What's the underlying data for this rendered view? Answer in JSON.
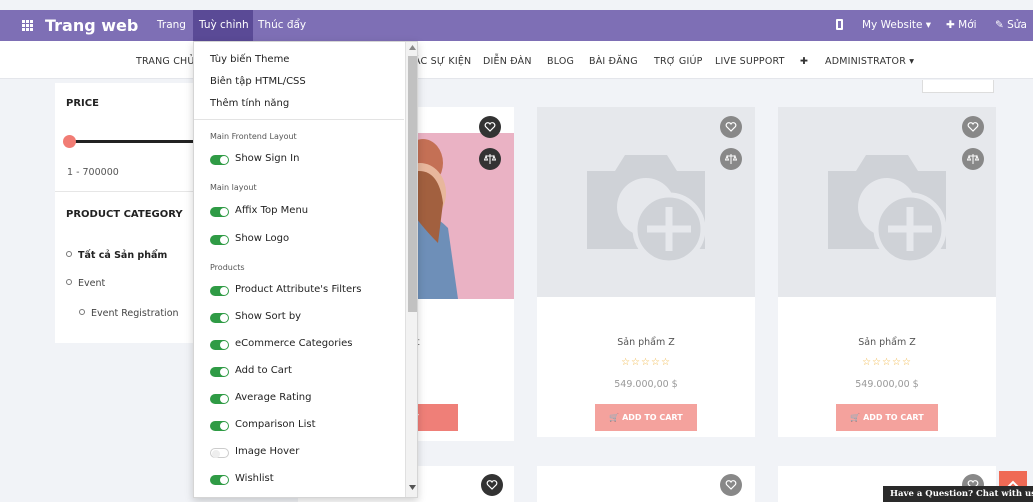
{
  "topbar": {
    "brand": "Trang web",
    "menu": [
      "Trang",
      "Tuỳ chỉnh",
      "Thúc đẩy"
    ],
    "website": "My Website ▾",
    "new": "✚ Mới",
    "edit": "✎ Sửa"
  },
  "sitenav": {
    "items": [
      "TRANG CHỦ",
      "ÁC SỰ KIỆN",
      "DIỄN ĐÀN",
      "BLOG",
      "BÀI ĐĂNG",
      "TRỢ GIÚP",
      "LIVE SUPPORT",
      "✚",
      "ADMINISTRATOR ▾"
    ]
  },
  "filter": {
    "price_title": "PRICE",
    "price_range": "1 - 700000",
    "category_title": "PRODUCT CATEGORY",
    "categories": [
      "Tất cả Sản phẩm",
      "Event",
      "Event Registration"
    ]
  },
  "dropdown": {
    "items": [
      "Tùy biến Theme",
      "Biên tập HTML/CSS",
      "Thêm tính năng"
    ],
    "sections": [
      "Main Frontend Layout",
      "Main layout",
      "Products"
    ],
    "toggles": [
      {
        "label": "Show Sign In",
        "on": true
      },
      {
        "label": "Affix Top Menu",
        "on": true
      },
      {
        "label": "Show Logo",
        "on": true
      },
      {
        "label": "Product Attribute's Filters",
        "on": true
      },
      {
        "label": "Show Sort by",
        "on": true
      },
      {
        "label": "eCommerce Categories",
        "on": true
      },
      {
        "label": "Add to Cart",
        "on": true
      },
      {
        "label": "Average Rating",
        "on": true
      },
      {
        "label": "Comparison List",
        "on": true
      },
      {
        "label": "Image Hover",
        "on": false
      },
      {
        "label": "Wishlist",
        "on": true
      }
    ]
  },
  "products": [
    {
      "name": "n test",
      "stars": "☆☆",
      "price": "$",
      "cart": "CART"
    },
    {
      "name": "Sản phẩm Z",
      "stars": "☆☆☆☆☆",
      "price": "549.000,00 $",
      "cart": "ADD TO CART"
    },
    {
      "name": "Sản phẩm Z",
      "stars": "☆☆☆☆☆",
      "price": "549.000,00 $",
      "cart": "ADD TO CART"
    }
  ],
  "chat": "Have a Question? Chat with us",
  "colors": {
    "topbar": "#7e6fb5",
    "active": "#5a4a96",
    "toggle_on": "#2f9b45",
    "cart_btn": "#f4a29d",
    "slider_knob": "#f17c74"
  }
}
